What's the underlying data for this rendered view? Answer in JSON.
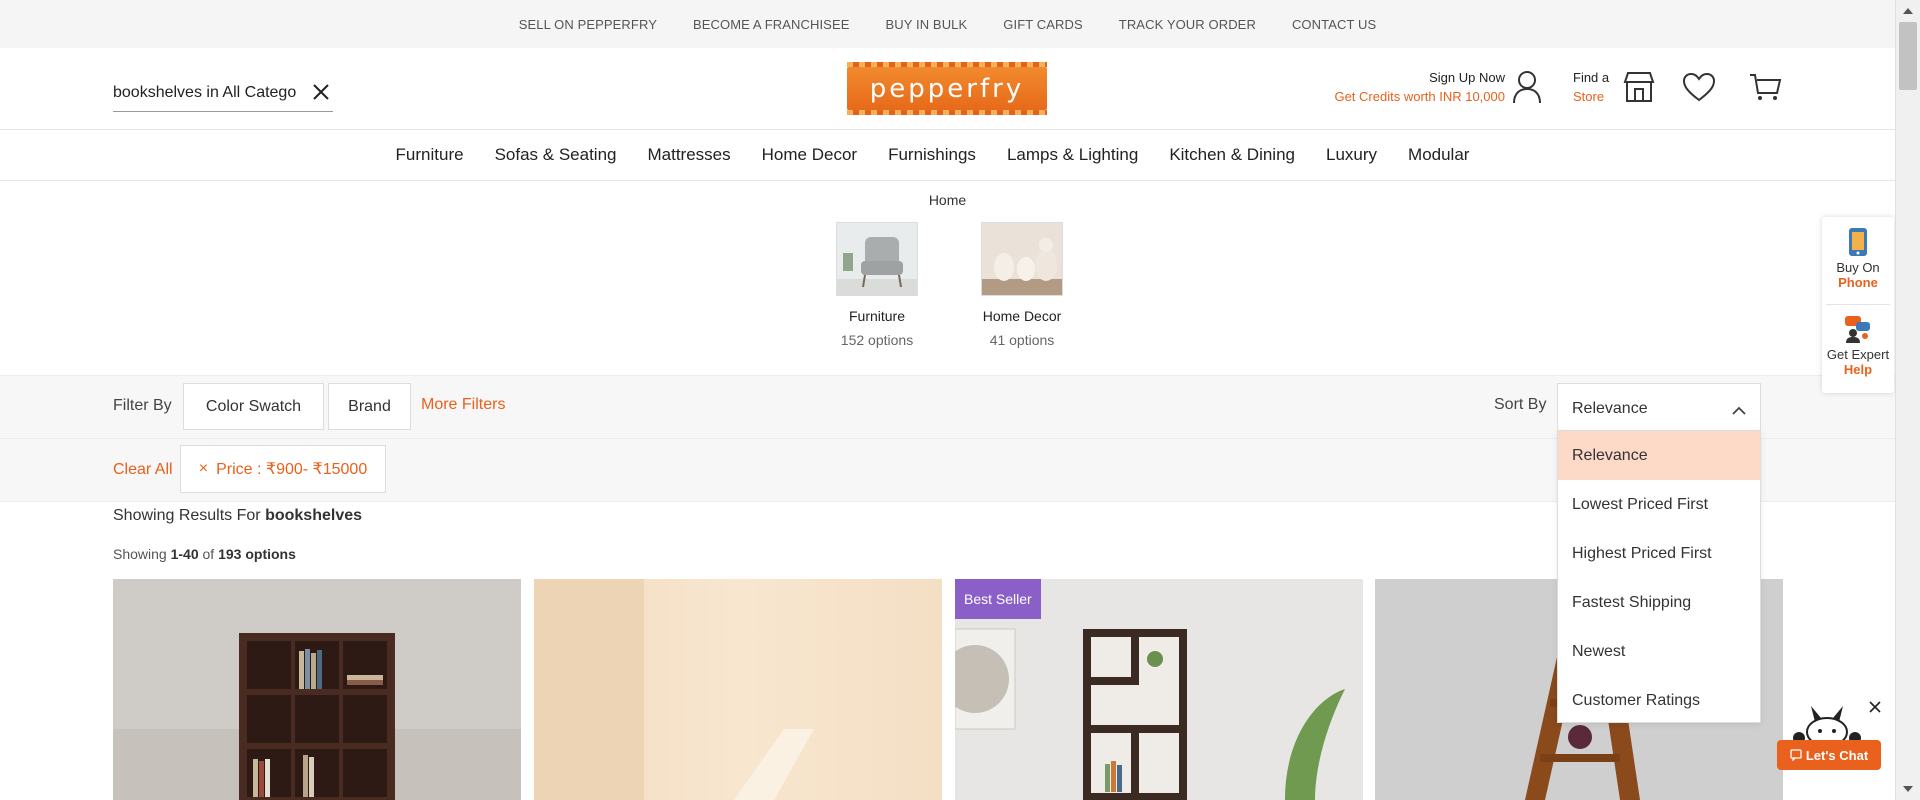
{
  "topbar": {
    "links": [
      "SELL ON PEPPERFRY",
      "BECOME A FRANCHISEE",
      "BUY IN BULK",
      "GIFT CARDS",
      "TRACK YOUR ORDER",
      "CONTACT US"
    ]
  },
  "header": {
    "search_value": "bookshelves in All Categories",
    "logo_text": "pepperfry",
    "signup_line1": "Sign Up Now",
    "signup_line2": "Get Credits worth INR 10,000",
    "findstore_line1": "Find a",
    "findstore_line2": "Store"
  },
  "nav": {
    "items": [
      "Furniture",
      "Sofas & Seating",
      "Mattresses",
      "Home Decor",
      "Furnishings",
      "Lamps & Lighting",
      "Kitchen & Dining",
      "Luxury",
      "Modular"
    ]
  },
  "breadcrumb": "Home",
  "categories": [
    {
      "name": "Furniture",
      "options": "152 options"
    },
    {
      "name": "Home Decor",
      "options": "41 options"
    }
  ],
  "filters": {
    "label": "Filter By",
    "chips": [
      "Color Swatch",
      "Brand"
    ],
    "more": "More Filters",
    "sort_label": "Sort By",
    "sort_value": "Relevance",
    "clear_all": "Clear All",
    "applied_chip": "Price : ₹900- ₹15000",
    "applied_close": "×"
  },
  "sort_options": [
    "Relevance",
    "Lowest Priced First",
    "Highest Priced First",
    "Fastest Shipping",
    "Newest",
    "Customer Ratings"
  ],
  "sort_selected": "Relevance",
  "results": {
    "prefix": "Showing Results For",
    "query": "bookshelves",
    "showing_prefix": "Showing",
    "range": "1-40",
    "of": "of",
    "total": "193 options"
  },
  "products": [
    {
      "badge": ""
    },
    {
      "badge": ""
    },
    {
      "badge": "Best Seller"
    },
    {
      "badge": ""
    }
  ],
  "side_float": {
    "phone_line1": "Buy On",
    "phone_line2": "Phone",
    "expert_line1": "Get Expert",
    "expert_line2": "Help"
  },
  "chat": {
    "label": "Let's Chat"
  },
  "colors": {
    "accent": "#e9611c",
    "active_option": "#fdd9c8",
    "badge": "#8b5fc8"
  }
}
